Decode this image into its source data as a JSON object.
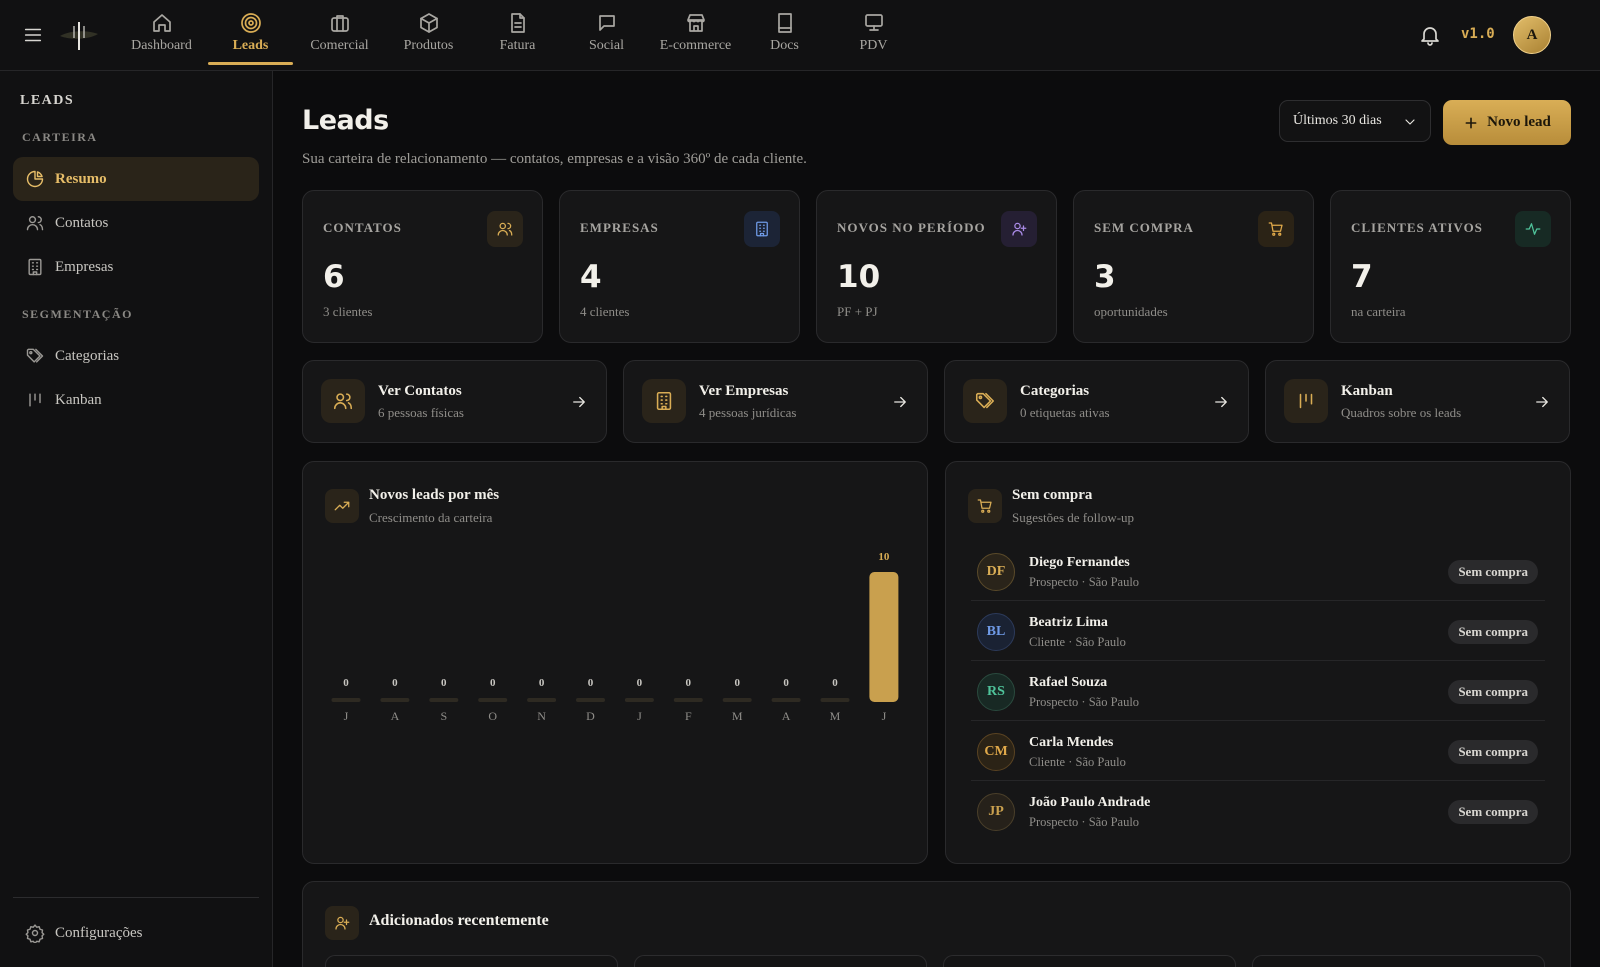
{
  "topbar": {
    "version": "v1.0",
    "avatar_initial": "A",
    "tabs": [
      {
        "label": "Dashboard",
        "icon": "home-icon"
      },
      {
        "label": "Leads",
        "icon": "target-icon"
      },
      {
        "label": "Comercial",
        "icon": "briefcase-icon"
      },
      {
        "label": "Produtos",
        "icon": "box-icon"
      },
      {
        "label": "Fatura",
        "icon": "file-text-icon"
      },
      {
        "label": "Social",
        "icon": "message-icon"
      },
      {
        "label": "E-commerce",
        "icon": "store-icon"
      },
      {
        "label": "Docs",
        "icon": "book-icon"
      },
      {
        "label": "PDV",
        "icon": "monitor-icon"
      }
    ],
    "active_tab": "Leads"
  },
  "sidebar": {
    "title": "LEADS",
    "section_carteira": "CARTEIRA",
    "section_segmentacao": "SEGMENTAÇÃO",
    "items": [
      {
        "label": "Resumo",
        "icon": "pie-chart-icon"
      },
      {
        "label": "Contatos",
        "icon": "users-icon"
      },
      {
        "label": "Empresas",
        "icon": "building-icon"
      },
      {
        "label": "Categorias",
        "icon": "tags-icon"
      },
      {
        "label": "Kanban",
        "icon": "kanban-icon"
      }
    ],
    "settings_label": "Configurações"
  },
  "header": {
    "title": "Leads",
    "subtitle": "Sua carteira de relacionamento — contatos, empresas e a visão 360º de cada cliente.",
    "period": "Últimos 30 dias",
    "new_lead": "Novo lead"
  },
  "stats": [
    {
      "label": "CONTATOS",
      "value": "6",
      "note": "3 clientes",
      "icon": "users-icon",
      "color": "#d9ad55"
    },
    {
      "label": "EMPRESAS",
      "value": "4",
      "note": "4 clientes",
      "icon": "building-icon",
      "color": "#6f9ae6"
    },
    {
      "label": "NOVOS NO PERÍODO",
      "value": "10",
      "note": "PF + PJ",
      "icon": "user-plus-icon",
      "color": "#a98ae6"
    },
    {
      "label": "SEM COMPRA",
      "value": "3",
      "note": "oportunidades",
      "icon": "cart-icon",
      "color": "#e0a94a"
    },
    {
      "label": "CLIENTES ATIVOS",
      "value": "7",
      "note": "na carteira",
      "icon": "activity-icon",
      "color": "#4fc39a"
    }
  ],
  "quick_links": [
    {
      "title": "Ver Contatos",
      "sub": "6 pessoas físicas",
      "icon": "users-icon"
    },
    {
      "title": "Ver Empresas",
      "sub": "4 pessoas jurídicas",
      "icon": "building-icon"
    },
    {
      "title": "Categorias",
      "sub": "0 etiquetas ativas",
      "icon": "tags-icon"
    },
    {
      "title": "Kanban",
      "sub": "Quadros sobre os leads",
      "icon": "kanban-icon"
    }
  ],
  "chart_panel": {
    "title": "Novos leads por mês",
    "subtitle": "Crescimento da carteira"
  },
  "chart_data": {
    "type": "bar",
    "categories": [
      "J",
      "A",
      "S",
      "O",
      "N",
      "D",
      "J",
      "F",
      "M",
      "A",
      "M",
      "J"
    ],
    "values": [
      0,
      0,
      0,
      0,
      0,
      0,
      0,
      0,
      0,
      0,
      0,
      10
    ],
    "title": "Novos leads por mês",
    "subtitle": "Crescimento da carteira",
    "ylim": [
      0,
      10
    ],
    "grid": false,
    "bar_color": "#c9a04e",
    "empty_bar_color": "#2e2a22"
  },
  "sem_compra_panel": {
    "title": "Sem compra",
    "subtitle": "Sugestões de follow-up",
    "people": [
      {
        "initials": "DF",
        "name": "Diego Fernandes",
        "meta": "Prospecto · São Paulo",
        "badge": "Sem compra",
        "color": "#d9ad55"
      },
      {
        "initials": "BL",
        "name": "Beatriz Lima",
        "meta": "Cliente · São Paulo",
        "badge": "Sem compra",
        "color": "#6f9ae6"
      },
      {
        "initials": "RS",
        "name": "Rafael Souza",
        "meta": "Prospecto · São Paulo",
        "badge": "Sem compra",
        "color": "#4fc39a"
      },
      {
        "initials": "CM",
        "name": "Carla Mendes",
        "meta": "Cliente · São Paulo",
        "badge": "Sem compra",
        "color": "#e0a94a"
      },
      {
        "initials": "JP",
        "name": "João Paulo Andrade",
        "meta": "Prospecto · São Paulo",
        "badge": "Sem compra",
        "color": "#c9a04e"
      }
    ]
  },
  "recent_panel": {
    "title": "Adicionados recentemente"
  }
}
